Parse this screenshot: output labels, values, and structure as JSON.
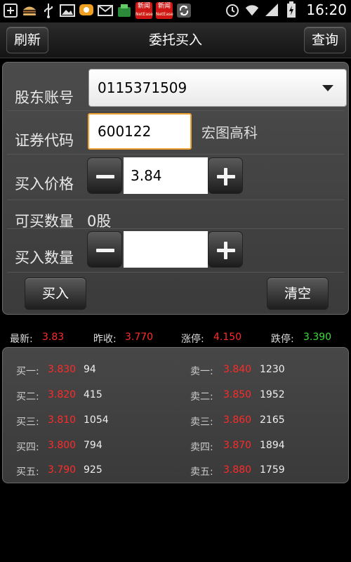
{
  "statusbar": {
    "icons": [
      "add-icon",
      "burger-app-icon",
      "usb-icon",
      "image-icon",
      "message-bubble-icon",
      "mail-icon",
      "app-store-icon",
      "news-app-icon",
      "news-app-icon",
      "sync-icon",
      "alarm-icon",
      "wifi-icon",
      "signal-icon",
      "battery-icon"
    ],
    "news_label": "新闻",
    "news_sub": "NetEase",
    "time": "16:20"
  },
  "titlebar": {
    "left_button": "刷新",
    "title": "委托买入",
    "right_button": "查询"
  },
  "form": {
    "account_label": "股东账号",
    "account_value": "0115371509",
    "code_label": "证券代码",
    "code_value": "600122",
    "stock_name": "宏图高科",
    "price_label": "买入价格",
    "price_value": "3.84",
    "available_label": "可买数量",
    "available_value": "0股",
    "quantity_label": "买入数量",
    "quantity_value": "",
    "buy_button": "买入",
    "clear_button": "清空"
  },
  "quote": {
    "latest_label": "最新:",
    "latest_value": "3.83",
    "prev_close_label": "昨收:",
    "prev_close_value": "3.770",
    "limit_up_label": "涨停:",
    "limit_up_value": "4.150",
    "limit_down_label": "跌停:",
    "limit_down_value": "3.390"
  },
  "order_book": {
    "bids": [
      {
        "label": "买一:",
        "price": "3.830",
        "volume": "94"
      },
      {
        "label": "买二:",
        "price": "3.820",
        "volume": "415"
      },
      {
        "label": "买三:",
        "price": "3.810",
        "volume": "1054"
      },
      {
        "label": "买四:",
        "price": "3.800",
        "volume": "794"
      },
      {
        "label": "买五:",
        "price": "3.790",
        "volume": "925"
      }
    ],
    "asks": [
      {
        "label": "卖一:",
        "price": "3.840",
        "volume": "1230"
      },
      {
        "label": "卖二:",
        "price": "3.850",
        "volume": "1952"
      },
      {
        "label": "卖三:",
        "price": "3.860",
        "volume": "2165"
      },
      {
        "label": "卖四:",
        "price": "3.870",
        "volume": "1894"
      },
      {
        "label": "卖五:",
        "price": "3.880",
        "volume": "1759"
      }
    ]
  },
  "colors": {
    "up": "#ff2a2a",
    "down": "#3ddc3d",
    "focus_border": "#f0a030"
  }
}
